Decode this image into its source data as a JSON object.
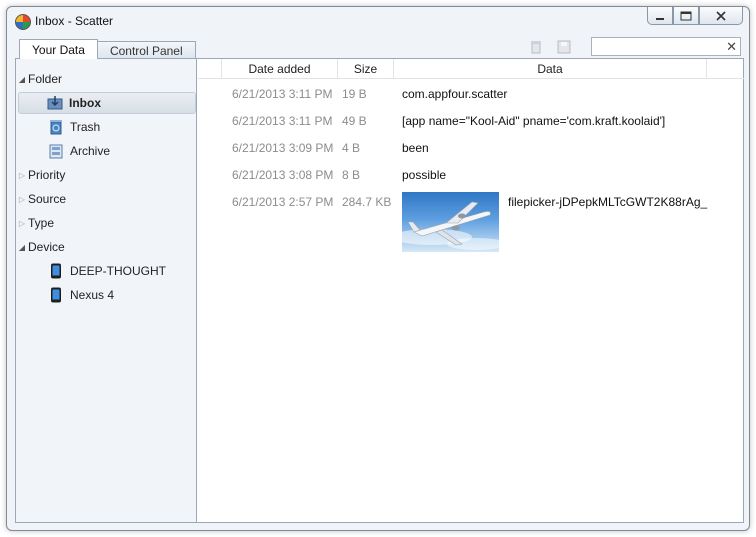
{
  "window": {
    "title": "Inbox - Scatter"
  },
  "tabs": [
    {
      "label": "Your Data",
      "active": true
    },
    {
      "label": "Control Panel",
      "active": false
    }
  ],
  "search": {
    "value": "",
    "placeholder": ""
  },
  "sidebar": {
    "folder": {
      "label": "Folder",
      "expanded": true
    },
    "folders": [
      {
        "label": "Inbox",
        "selected": true,
        "icon": "inbox-icon"
      },
      {
        "label": "Trash",
        "icon": "trash-icon"
      },
      {
        "label": "Archive",
        "icon": "archive-icon"
      }
    ],
    "groups": [
      {
        "label": "Priority",
        "expanded": false
      },
      {
        "label": "Source",
        "expanded": false
      },
      {
        "label": "Type",
        "expanded": false
      }
    ],
    "device": {
      "label": "Device",
      "expanded": true
    },
    "devices": [
      {
        "label": "DEEP-THOUGHT",
        "icon": "phone-icon"
      },
      {
        "label": "Nexus 4",
        "icon": "phone-icon"
      }
    ]
  },
  "table": {
    "columns": [
      "Date added",
      "Size",
      "Data"
    ],
    "rows": [
      {
        "date": "6/21/2013 3:11 PM",
        "size": "19 B",
        "data": "com.appfour.scatter"
      },
      {
        "date": "6/21/2013 3:11 PM",
        "size": "49 B",
        "data": "[app name=\"Kool-Aid\" pname='com.kraft.koolaid']"
      },
      {
        "date": "6/21/2013 3:09 PM",
        "size": "4 B",
        "data": "been"
      },
      {
        "date": "6/21/2013 3:08 PM",
        "size": "8 B",
        "data": "possible"
      },
      {
        "date": "6/21/2013 2:57 PM",
        "size": "284.7 KB",
        "data": "filepicker-jDPepkMLTcGWT2K88rAg_",
        "image": "airplane-photo"
      }
    ]
  },
  "colors": {
    "selected_bg": "#dde3ea",
    "muted_text": "#8c8c8c",
    "sidebar_bg": "#f1f5f9"
  }
}
